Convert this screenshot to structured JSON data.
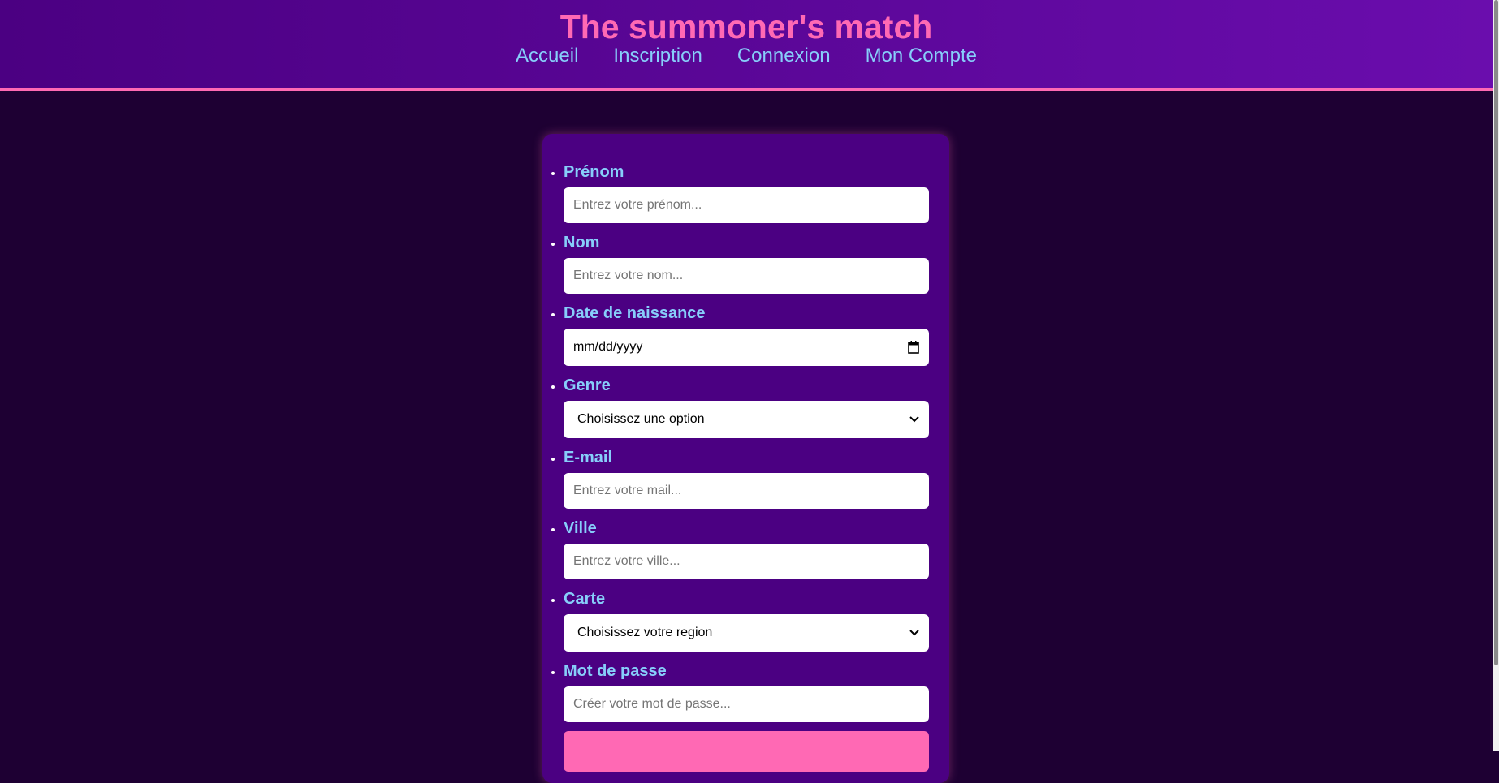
{
  "header": {
    "title": "The summoner's match",
    "nav": [
      "Accueil",
      "Inscription",
      "Connexion",
      "Mon Compte"
    ]
  },
  "form": {
    "fields": [
      {
        "label": "Prénom",
        "placeholder": "Entrez votre prénom..."
      },
      {
        "label": "Nom",
        "placeholder": "Entrez votre nom..."
      },
      {
        "label": "Date de naissance",
        "value": "mm/dd/yyyy"
      },
      {
        "label": "Genre",
        "value": "Choisissez une option"
      },
      {
        "label": "E-mail",
        "placeholder": "Entrez votre mail..."
      },
      {
        "label": "Ville",
        "placeholder": "Entrez votre ville..."
      },
      {
        "label": "Carte",
        "value": "Choisissez votre region"
      },
      {
        "label": "Mot de passe",
        "placeholder": "Créer votre mot de passe..."
      }
    ]
  },
  "colors": {
    "accent": "#ff69b4",
    "label": "#87cefa",
    "card": "#4b0082",
    "background": "#1e0033"
  }
}
